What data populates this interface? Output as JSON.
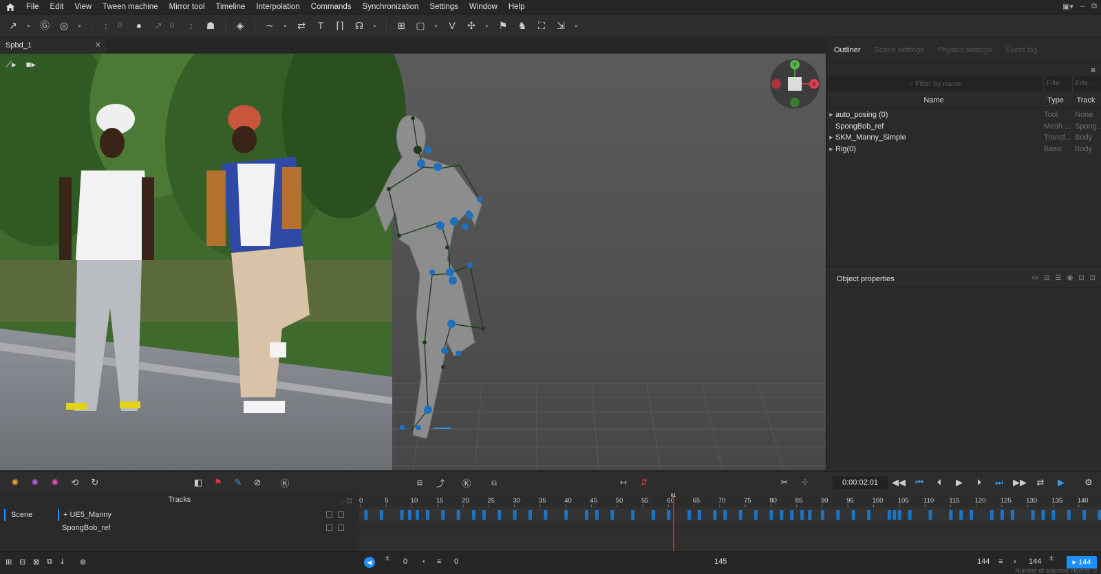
{
  "menubar": {
    "items": [
      "File",
      "Edit",
      "View",
      "Tween machine",
      "Mirror tool",
      "Timeline",
      "Interpolation",
      "Commands",
      "Synchronization",
      "Settings",
      "Window",
      "Help"
    ]
  },
  "toolbar": {
    "values": [
      "0",
      "0"
    ]
  },
  "document": {
    "tab_title": "Spbd_1",
    "close_glyph": "✕"
  },
  "outliner": {
    "tabs": [
      "Outliner",
      "Scene settings",
      "Physics settings",
      "Event log"
    ],
    "filter_placeholder": "Filter by name",
    "small_filter_1": "Filte...",
    "small_filter_2": "Filte...",
    "columns": {
      "name": "Name",
      "type": "Type",
      "track": "Track"
    },
    "rows": [
      {
        "name": "auto_posing (0)",
        "type": "Tool",
        "track": "None",
        "expandable": true
      },
      {
        "name": "SpongBob_ref",
        "type": "Mesh ...",
        "track": "Spong...",
        "expandable": false
      },
      {
        "name": "SKM_Manny_Simple",
        "type": "Transf...",
        "track": "Body",
        "expandable": true
      },
      {
        "name": "Rig(0)",
        "type": "Basic",
        "track": "Body",
        "expandable": true
      }
    ]
  },
  "properties": {
    "title": "Object properties"
  },
  "playback": {
    "time": "0:00:02:01"
  },
  "tracks": {
    "header": "Tracks",
    "scene_label": "Scene",
    "items": [
      "+ UE5_Manny",
      "SpongBob_ref"
    ]
  },
  "timeline": {
    "ticks": [
      "0",
      "5",
      "10",
      "15",
      "20",
      "25",
      "30",
      "35",
      "40",
      "45",
      "50",
      "55",
      "60",
      "65",
      "70",
      "75",
      "80",
      "85",
      "90",
      "95",
      "100",
      "105",
      "110",
      "115",
      "120",
      "125",
      "130",
      "135",
      "140"
    ],
    "current_frame": "61",
    "current_frame_value": 61,
    "total_frames": 145,
    "keyframes": [
      1,
      4,
      8,
      9.5,
      11,
      13,
      16,
      19,
      22,
      24,
      27,
      30,
      33,
      36,
      40,
      44,
      46,
      49,
      53,
      57,
      60,
      64,
      66,
      69,
      71,
      74,
      77,
      80,
      82,
      84,
      86,
      87.5,
      90,
      93,
      96,
      99,
      103,
      104,
      105,
      107,
      111,
      115,
      117,
      119,
      123,
      125,
      127,
      131,
      133,
      135,
      138,
      141,
      144
    ]
  },
  "bottombar": {
    "range_start": "0",
    "offset": "0",
    "center": "145",
    "end_a": "144",
    "end_b": "144",
    "end_chip": "144",
    "status": "Number of selected objects: 0"
  },
  "colors": {
    "accent": "#1e8fff",
    "playhead": "#e02c2c",
    "keyframe": "#1c74c4"
  }
}
